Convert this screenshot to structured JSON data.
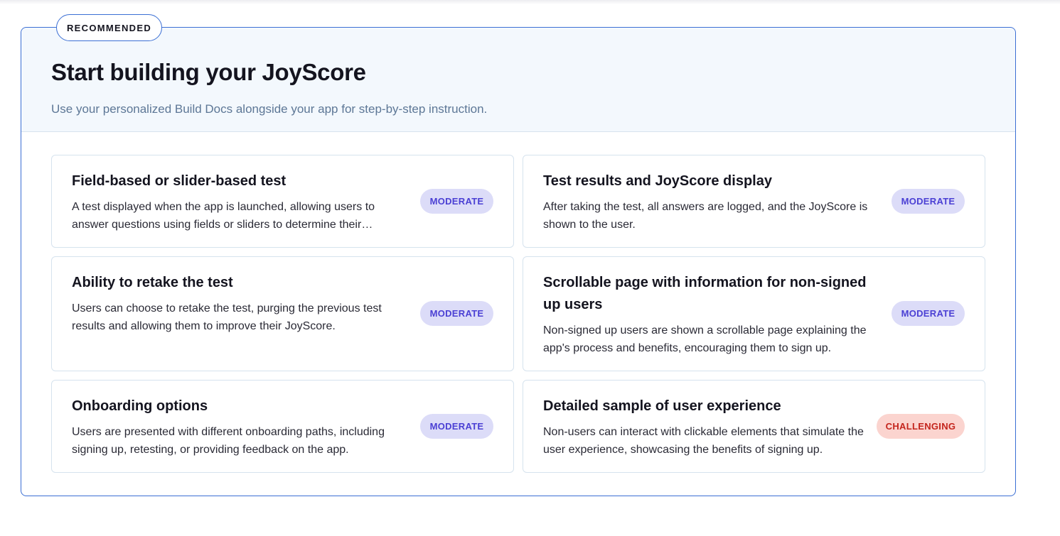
{
  "panel": {
    "tag": "RECOMMENDED",
    "title": "Start building your JoyScore",
    "subtitle": "Use your personalized Build Docs alongside your app for step-by-step instruction."
  },
  "features": [
    {
      "title": "Field-based or slider-based test",
      "description": "A test displayed when the app is launched, allowing users to answer questions using fields or sliders to determine their…",
      "difficulty": "MODERATE"
    },
    {
      "title": "Test results and JoyScore display",
      "description": "After taking the test, all answers are logged, and the JoyScore is shown to the user.",
      "difficulty": "MODERATE"
    },
    {
      "title": "Ability to retake the test",
      "description": "Users can choose to retake the test, purging the previous test results and allowing them to improve their JoyScore.",
      "difficulty": "MODERATE"
    },
    {
      "title": "Scrollable page with information for non-signed up users",
      "description": "Non-signed up users are shown a scrollable page explaining the app's process and benefits, encouraging them to sign up.",
      "difficulty": "MODERATE"
    },
    {
      "title": "Onboarding options",
      "description": "Users are presented with different onboarding paths, including signing up, retesting, or providing feedback on the app.",
      "difficulty": "MODERATE"
    },
    {
      "title": "Detailed sample of user experience",
      "description": "Non-users can interact with clickable elements that simulate the user experience, showcasing the benefits of signing up.",
      "difficulty": "CHALLENGING"
    }
  ],
  "colors": {
    "accent_border": "#3b6fd4",
    "header_bg": "#f3f8fd",
    "moderate_bg": "#dcdcf8",
    "moderate_text": "#4b40d4",
    "challenging_bg": "#fbd4cf",
    "challenging_text": "#c4251d"
  }
}
